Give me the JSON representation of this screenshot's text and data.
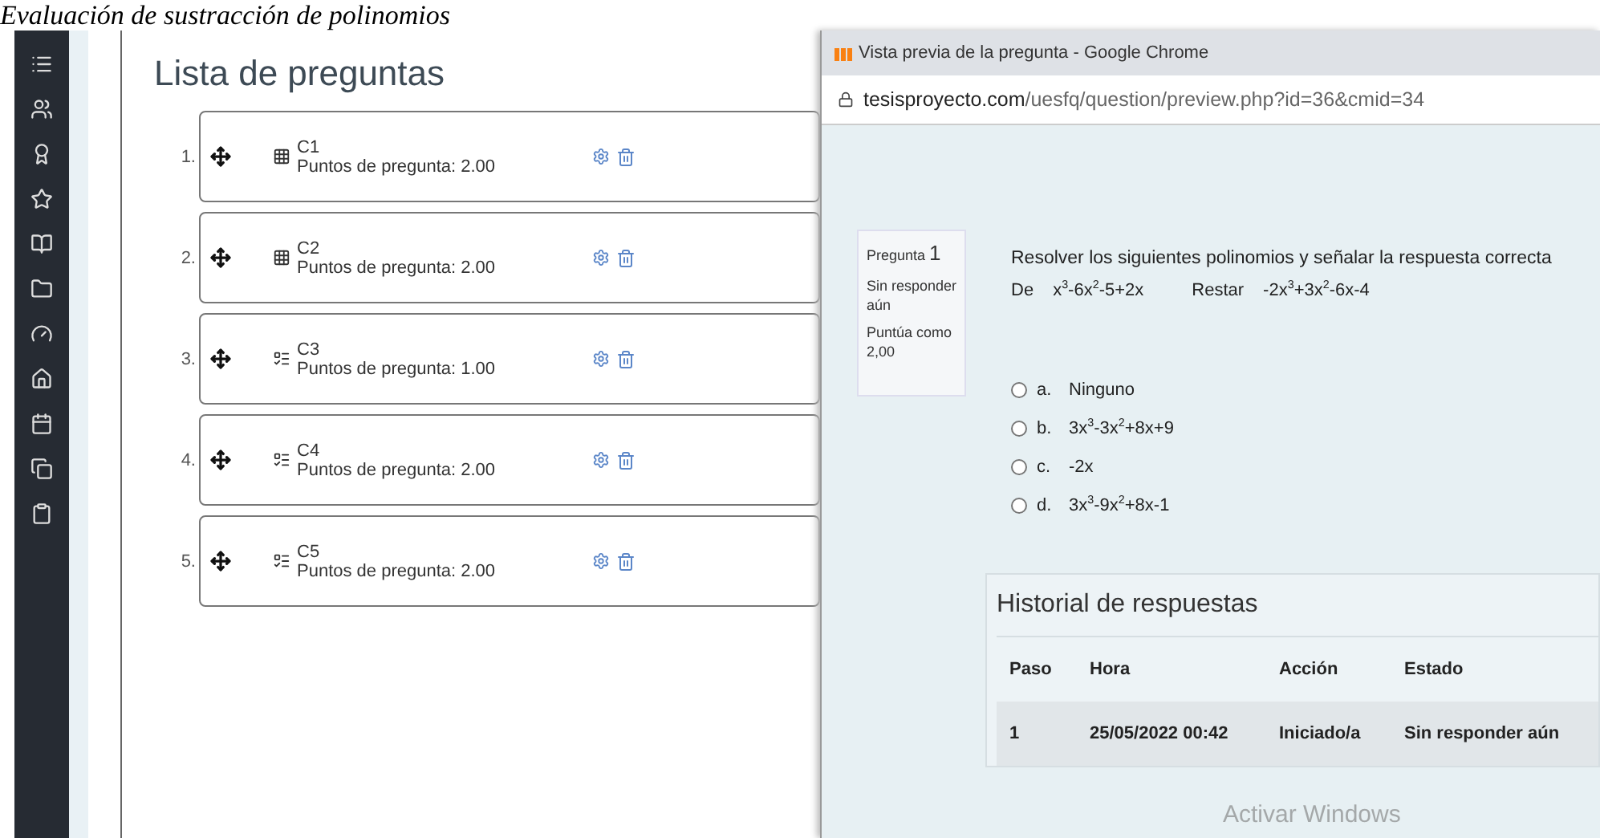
{
  "document_heading": "Evaluación de sustracción de polinomios",
  "question_list": {
    "title": "Lista de preguntas",
    "items": [
      {
        "number": "1.",
        "name": "C1",
        "points": "Puntos de pregunta: 2.00",
        "kind": "grid"
      },
      {
        "number": "2.",
        "name": "C2",
        "points": "Puntos de pregunta: 2.00",
        "kind": "grid"
      },
      {
        "number": "3.",
        "name": "C3",
        "points": "Puntos de pregunta: 1.00",
        "kind": "list"
      },
      {
        "number": "4.",
        "name": "C4",
        "points": "Puntos de pregunta: 2.00",
        "kind": "list"
      },
      {
        "number": "5.",
        "name": "C5",
        "points": "Puntos de pregunta: 2.00",
        "kind": "list"
      }
    ]
  },
  "browser": {
    "title": "Vista previa de la pregunta - Google Chrome",
    "url_host": "tesisproyecto.com",
    "url_path": "/uesfq/question/preview.php?id=36&cmid=34",
    "info": {
      "label": "Pregunta",
      "number": "1",
      "status": "Sin responder aún",
      "grade": "Puntúa como 2,00"
    },
    "question": {
      "text": "Resolver los siguientes polinomios y señalar la respuesta correcta",
      "from_label": "De",
      "from": "x$^{3}$-6x$^{2}$-5+2x",
      "subtract_label": "Restar",
      "subtract": "-2x$^{3}$+3x$^{2}$-6x-4"
    },
    "answers": [
      {
        "letter": "a.",
        "text": "Ninguno",
        "selected": false
      },
      {
        "letter": "b.",
        "text": "3x$^{3}$-3x$^{2}$+8x+9",
        "selected": false
      },
      {
        "letter": "c.",
        "text": "-2x",
        "selected": false
      },
      {
        "letter": "d.",
        "text": "3x$^{3}$-9x$^{2}$+8x-1",
        "selected": false
      }
    ],
    "history": {
      "title": "Historial de respuestas",
      "columns": [
        "Paso",
        "Hora",
        "Acción",
        "Estado"
      ],
      "rows": [
        [
          "1",
          "25/05/2022 00:42",
          "Iniciado/a",
          "Sin responder aún"
        ]
      ]
    }
  },
  "os_notice": "Activar Windows"
}
